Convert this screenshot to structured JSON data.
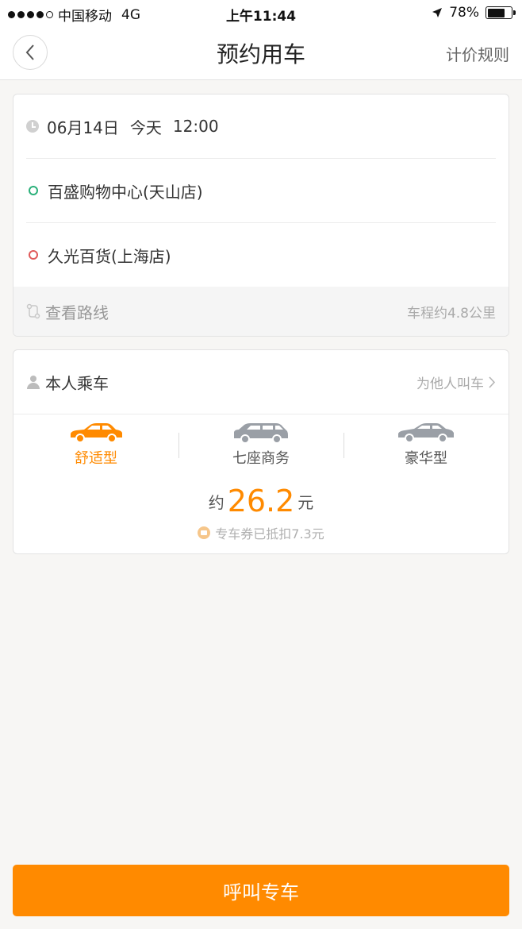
{
  "status_bar": {
    "carrier": "中国移动",
    "network": "4G",
    "time": "上午11:44",
    "battery": "78%",
    "battery_level": 0.78
  },
  "nav": {
    "back_icon": "chevron-left-icon",
    "title": "预约用车",
    "right_action": "计价规则"
  },
  "trip": {
    "date": "06月14日",
    "day": "今天",
    "time": "12:00",
    "start": "百盛购物中心(天山店)",
    "end": "久光百货(上海店)",
    "route_label": "查看路线",
    "distance": "车程约4.8公里"
  },
  "rider": {
    "label": "本人乘车",
    "other": "为他人叫车"
  },
  "car_types": [
    {
      "label": "舒适型",
      "active": true,
      "color": "#ff8a00"
    },
    {
      "label": "七座商务",
      "active": false,
      "color": "#9a9fa6"
    },
    {
      "label": "豪华型",
      "active": false,
      "color": "#9a9fa6"
    }
  ],
  "price": {
    "prefix": "约",
    "value": "26.2",
    "unit": "元",
    "coupon": "专车券已抵扣7.3元"
  },
  "call_button": "呼叫专车",
  "colors": {
    "accent": "#ff8a00",
    "start_dot": "#2bb07a",
    "end_dot": "#e05a5a"
  }
}
